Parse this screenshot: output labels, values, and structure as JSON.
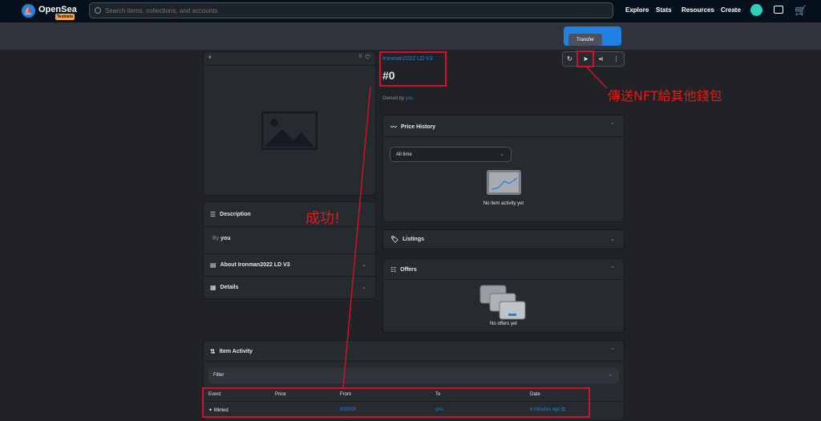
{
  "nav": {
    "brand": "OpenSea",
    "badge": "Testnets",
    "search_placeholder": "Search items, collections, and accounts",
    "links": [
      "Explore",
      "Stats",
      "Resources",
      "Create"
    ]
  },
  "tooltip": "Transfer",
  "item": {
    "collection": "Ironman2022 LD V3",
    "title": "#0",
    "owned_by_prefix": "Owned by",
    "owner": "you",
    "favorites": "0"
  },
  "description": {
    "heading": "Description",
    "by_prefix": "By",
    "by_name": "you",
    "about": "About Ironman2022 LD V3",
    "details": "Details"
  },
  "price_history": {
    "heading": "Price History",
    "range": "All time",
    "empty": "No item activity yet"
  },
  "listings": {
    "heading": "Listings"
  },
  "offers": {
    "heading": "Offers",
    "empty": "No offers yet"
  },
  "activity": {
    "heading": "Item Activity",
    "filter": "Filter",
    "columns": [
      "Event",
      "Price",
      "From",
      "To",
      "Date"
    ],
    "rows": [
      {
        "event": "Minted",
        "price": "",
        "from": "000000",
        "to": "you",
        "date": "6 minutes ago"
      }
    ]
  },
  "annotations": {
    "transfer_note": "傳送NFT給其他錢包",
    "success": "成功!"
  },
  "colors": {
    "accent": "#2081e2",
    "highlight": "#d0112b",
    "background": "#202225",
    "panel": "#262b2f"
  }
}
